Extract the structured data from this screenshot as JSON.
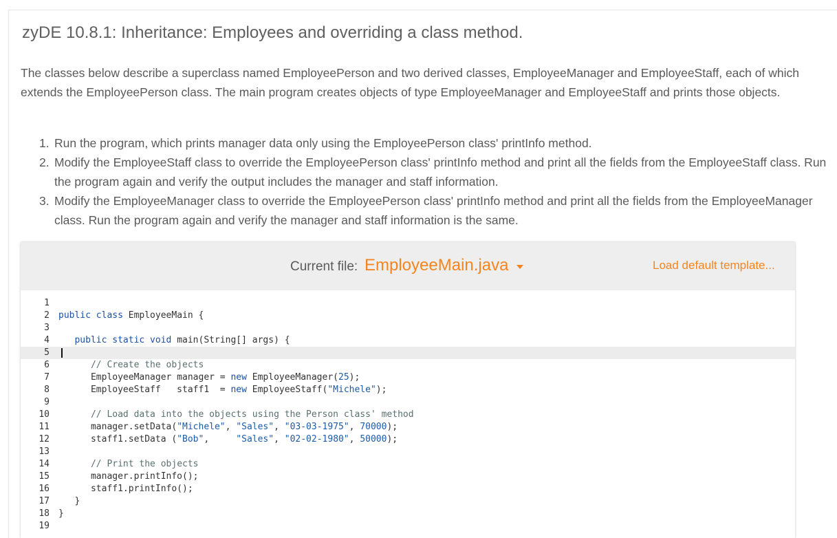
{
  "header": {
    "title": "zyDE 10.8.1: Inheritance: Employees and overriding a class method."
  },
  "description": "The classes below describe a superclass named EmployeePerson and two derived classes, EmployeeManager and EmployeeStaff, each of which extends the EmployeePerson class. The main program creates objects of type EmployeeManager and EmployeeStaff and prints those objects.",
  "steps": [
    {
      "num": "1.",
      "text": "Run the program, which prints manager data only using the EmployeePerson class' printInfo method."
    },
    {
      "num": "2.",
      "text": "Modify the EmployeeStaff class to override the EmployeePerson class' printInfo method and print all the fields from the EmployeeStaff class. Run the program again and verify the output includes the manager and staff information."
    },
    {
      "num": "3.",
      "text": "Modify the EmployeeManager class to override the EmployeePerson class' printInfo method and print all the fields from the EmployeeManager class. Run the program again and verify the manager and staff information is the same."
    }
  ],
  "editor": {
    "current_file_label": "Current file:",
    "current_file_name": "EmployeeMain.java",
    "load_template_label": "Load default template...",
    "active_line": 5,
    "colors": {
      "accent": "#f5851f",
      "keyword": "#1c4fa6",
      "comment": "#5a6f6f"
    },
    "lines": [
      {
        "n": "1",
        "tokens": []
      },
      {
        "n": "2",
        "tokens": [
          [
            "kw",
            "public class "
          ],
          [
            "t",
            "EmployeeMain {"
          ]
        ]
      },
      {
        "n": "3",
        "tokens": []
      },
      {
        "n": "4",
        "tokens": [
          [
            "t",
            "   "
          ],
          [
            "kw",
            "public static void "
          ],
          [
            "t",
            "main(String[] args) {"
          ]
        ]
      },
      {
        "n": "5",
        "tokens": []
      },
      {
        "n": "6",
        "tokens": [
          [
            "t",
            "      "
          ],
          [
            "cm",
            "// Create the objects"
          ]
        ]
      },
      {
        "n": "7",
        "tokens": [
          [
            "t",
            "      EmployeeManager manager = "
          ],
          [
            "kw",
            "new "
          ],
          [
            "t",
            "EmployeeManager("
          ],
          [
            "num",
            "25"
          ],
          [
            "t",
            ");"
          ]
        ]
      },
      {
        "n": "8",
        "tokens": [
          [
            "t",
            "      EmployeeStaff   staff1  = "
          ],
          [
            "kw",
            "new "
          ],
          [
            "t",
            "EmployeeStaff("
          ],
          [
            "str",
            "\"Michele\""
          ],
          [
            "t",
            ");"
          ]
        ]
      },
      {
        "n": "9",
        "tokens": []
      },
      {
        "n": "10",
        "tokens": [
          [
            "t",
            "      "
          ],
          [
            "cm",
            "// Load data into the objects using the Person class' method"
          ]
        ]
      },
      {
        "n": "11",
        "tokens": [
          [
            "t",
            "      manager.setData("
          ],
          [
            "str",
            "\"Michele\""
          ],
          [
            "t",
            ", "
          ],
          [
            "str",
            "\"Sales\""
          ],
          [
            "t",
            ", "
          ],
          [
            "str",
            "\"03-03-1975\""
          ],
          [
            "t",
            ", "
          ],
          [
            "num",
            "70000"
          ],
          [
            "t",
            ");"
          ]
        ]
      },
      {
        "n": "12",
        "tokens": [
          [
            "t",
            "      staff1.setData ("
          ],
          [
            "str",
            "\"Bob\""
          ],
          [
            "t",
            ",     "
          ],
          [
            "str",
            "\"Sales\""
          ],
          [
            "t",
            ", "
          ],
          [
            "str",
            "\"02-02-1980\""
          ],
          [
            "t",
            ", "
          ],
          [
            "num",
            "50000"
          ],
          [
            "t",
            ");"
          ]
        ]
      },
      {
        "n": "13",
        "tokens": []
      },
      {
        "n": "14",
        "tokens": [
          [
            "t",
            "      "
          ],
          [
            "cm",
            "// Print the objects"
          ]
        ]
      },
      {
        "n": "15",
        "tokens": [
          [
            "t",
            "      manager.printInfo();"
          ]
        ]
      },
      {
        "n": "16",
        "tokens": [
          [
            "t",
            "      staff1.printInfo();"
          ]
        ]
      },
      {
        "n": "17",
        "tokens": [
          [
            "t",
            "   }"
          ]
        ]
      },
      {
        "n": "18",
        "tokens": [
          [
            "t",
            "}"
          ]
        ]
      },
      {
        "n": "19",
        "tokens": []
      }
    ]
  }
}
